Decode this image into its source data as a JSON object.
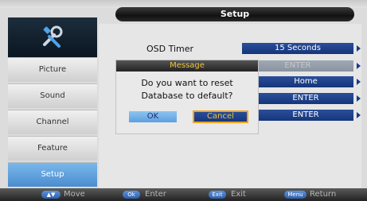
{
  "header": {
    "title": "Setup"
  },
  "sidebar": {
    "icon": "tools-icon",
    "items": [
      {
        "label": "Picture"
      },
      {
        "label": "Sound"
      },
      {
        "label": "Channel"
      },
      {
        "label": "Feature"
      },
      {
        "label": "Setup",
        "active": true
      }
    ]
  },
  "main": {
    "rows": [
      {
        "label": "OSD Timer",
        "value": "15 Seconds"
      },
      {
        "value": "ENTER"
      },
      {
        "value": "Home"
      },
      {
        "value": "ENTER"
      },
      {
        "value": "ENTER"
      }
    ]
  },
  "dialog": {
    "title": "Message",
    "line1": "Do you want to reset",
    "line2": "Database to default?",
    "ok": "OK",
    "cancel": "Cancel"
  },
  "footer": {
    "move_key": "▲▼",
    "move": "Move",
    "enter_key": "Ok",
    "enter": "Enter",
    "exit_key": "Exit",
    "exit": "Exit",
    "return_key": "Menu",
    "return": "Return"
  },
  "colors": {
    "accent_blue": "#1a3b84",
    "highlight_orange": "#f2a21c",
    "title_yellow": "#f2c23a",
    "active_tab": "#4a8cd0"
  }
}
